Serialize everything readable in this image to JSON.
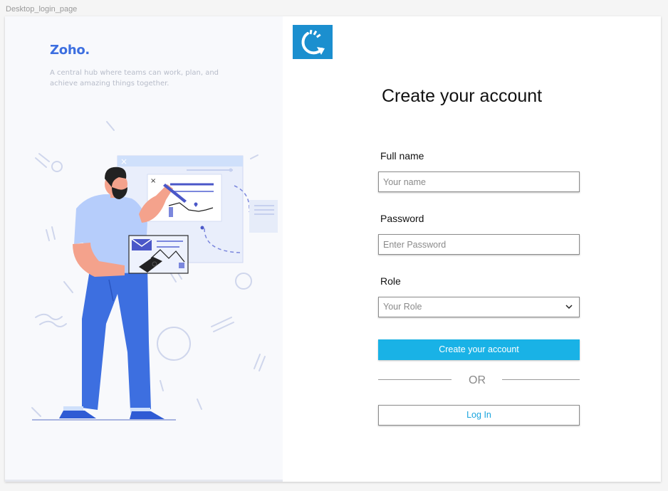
{
  "frame": {
    "label": "Desktop_login_page"
  },
  "brand": {
    "name": "Zoho.",
    "tagline": "A central hub where teams can work, plan, and achieve amazing things together."
  },
  "illustration": {
    "icon": "person-with-dashboard-illustration"
  },
  "logo": {
    "icon": "refresh-arrow-icon",
    "color": "#1b8fcf"
  },
  "form": {
    "title": "Create your account",
    "full_name": {
      "label": "Full name",
      "placeholder": "Your name"
    },
    "password": {
      "label": "Password",
      "placeholder": "Enter Password"
    },
    "role": {
      "label": "Role",
      "placeholder": "Your Role"
    },
    "submit_label": "Create your account",
    "divider_text": "OR",
    "login_label": "Log In"
  },
  "colors": {
    "primary": "#19b2e6",
    "brand": "#3d6fe0",
    "link": "#19a4dd"
  }
}
